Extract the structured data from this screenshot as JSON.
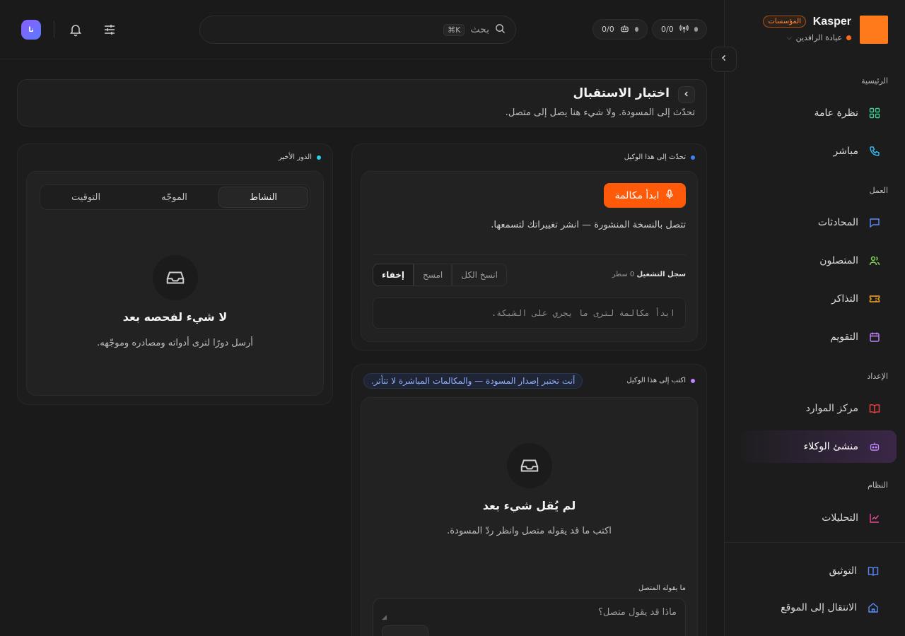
{
  "brand": {
    "name": "Kasper",
    "badge": "المؤسسات",
    "workspace": "عيادة الرافدين",
    "logo_color": "#ff7a1a"
  },
  "sidebar": {
    "sections": {
      "home": "الرئيسية",
      "work": "العمل",
      "setup": "الإعداد",
      "system": "النظام"
    },
    "items": [
      {
        "label": "نظرة عامة",
        "icon": "grid-icon",
        "color": "#3ecf8e"
      },
      {
        "label": "مباشر",
        "icon": "phone-icon",
        "color": "#38bdf8"
      },
      {
        "label": "المحادثات",
        "icon": "chat-icon",
        "color": "#5b8cff"
      },
      {
        "label": "المتصلون",
        "icon": "users-icon",
        "color": "#7ed957"
      },
      {
        "label": "التذاكر",
        "icon": "ticket-icon",
        "color": "#f5a623"
      },
      {
        "label": "التقويم",
        "icon": "calendar-icon",
        "color": "#c084fc"
      },
      {
        "label": "مركز الموارد",
        "icon": "book-icon",
        "color": "#ef4444"
      },
      {
        "label": "منشئ الوكلاء",
        "icon": "bot-icon",
        "color": "#c084fc",
        "active": true
      },
      {
        "label": "التحليلات",
        "icon": "chart-icon",
        "color": "#ec4899"
      }
    ],
    "footer": [
      {
        "label": "التوثيق",
        "icon": "docs-icon",
        "color": "#5b8cff"
      },
      {
        "label": "الانتقال إلى الموقع",
        "icon": "home-icon",
        "color": "#5b8cff"
      }
    ]
  },
  "topbar": {
    "live_count": "0/0",
    "bot_count": "0/0",
    "search_placeholder": "بحث",
    "search_shortcut": "⌘K",
    "avatar_initials": "نا"
  },
  "header": {
    "title": "اختبار الاستقبال",
    "subtitle": "تحدّث إلى المسودة. ولا شيء هنا يصل إلى متصل."
  },
  "talk_panel": {
    "label": "تحدّث إلى هذا الوكيل",
    "dot_color": "#3b82f6",
    "call_button": "ابدأ مكالمة",
    "description": "تتصل بالنسخة المنشورة — انشر تغييراتك لتسمعها.",
    "log_title": "سجل التشغيل",
    "log_count": "0 سطر",
    "copy_all": "انسخ الكل",
    "clear": "امسح",
    "hide": "إخفاء",
    "log_placeholder": "ابدأ مكالمة لترى ما يجري على الشبكة."
  },
  "write_panel": {
    "label": "اكتب إلى هذا الوكيل",
    "dot_color": "#c084fc",
    "notice": "أنت تختبر إصدار المسودة — والمكالمات المباشرة لا تتأثر.",
    "empty_title": "لم يُقل شيء بعد",
    "empty_sub": "اكتب ما قد يقوله متصل وانظر ردّ المسودة.",
    "field_label": "ما يقوله المتصل",
    "input_placeholder": "ماذا قد يقول متصل؟"
  },
  "turn_panel": {
    "label": "الدور الأخير",
    "dot_color": "#22d3ee",
    "tabs": [
      "النشاط",
      "الموجّه",
      "التوقيت"
    ],
    "active_tab": 0,
    "empty_title": "لا شيء لفحصه بعد",
    "empty_sub": "أرسل دورًا لترى أدواته ومصادره وموجّهه."
  }
}
